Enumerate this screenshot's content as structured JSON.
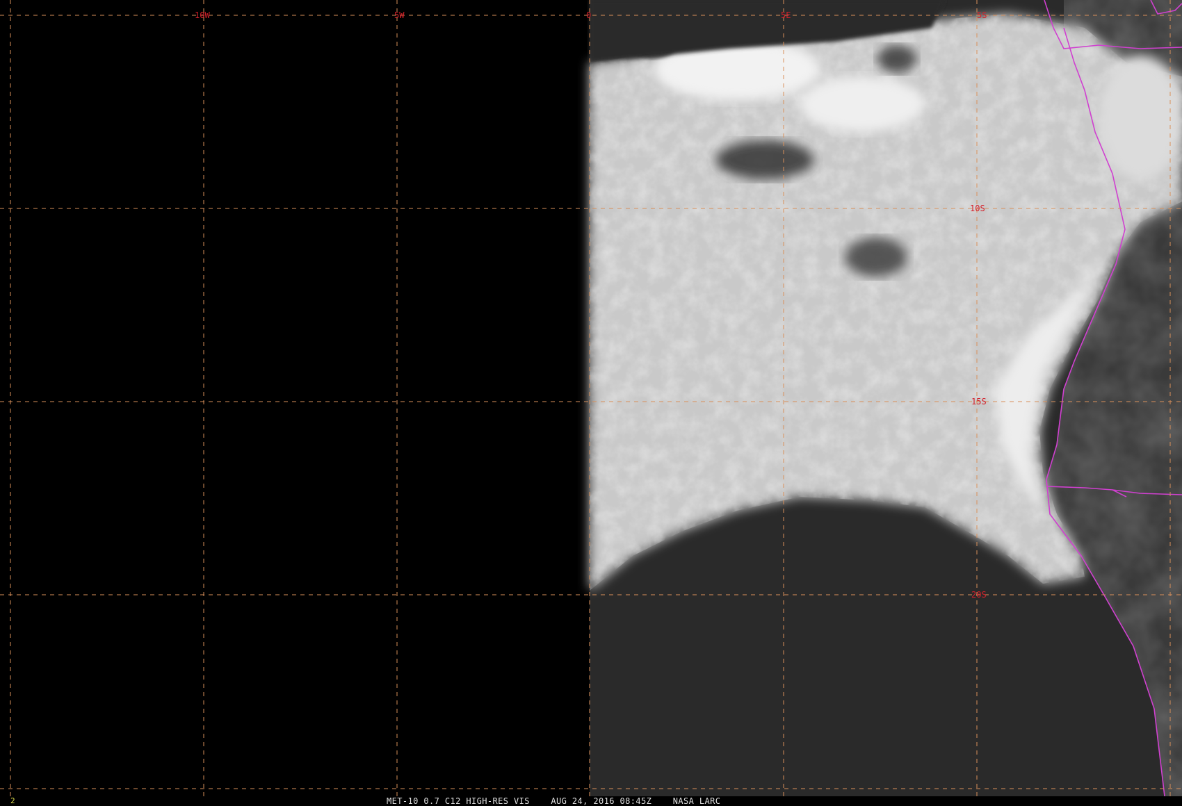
{
  "image": {
    "product": "MET-10 0.7 C12 HIGH-RES VIS",
    "datetime": "AUG 24, 2016 08:45Z",
    "source": "NASA LARC",
    "frame_number": "2"
  },
  "grid": {
    "longitude_labels": [
      "10W",
      "5W",
      "0",
      "5E",
      "5S"
    ],
    "latitude_labels": [
      "10S",
      "15S",
      "20S"
    ]
  },
  "colors": {
    "grid_line": "#d9905a",
    "grid_label": "#d4202a",
    "boundary": "#d040d0",
    "no_data": "#000000",
    "ocean": "#2a2a2a",
    "land": "#3c3c3c",
    "cloud": "#d8d8d8"
  },
  "icons": {
    "map": "satellite-imagery",
    "boundaries": "country-border-lines"
  }
}
